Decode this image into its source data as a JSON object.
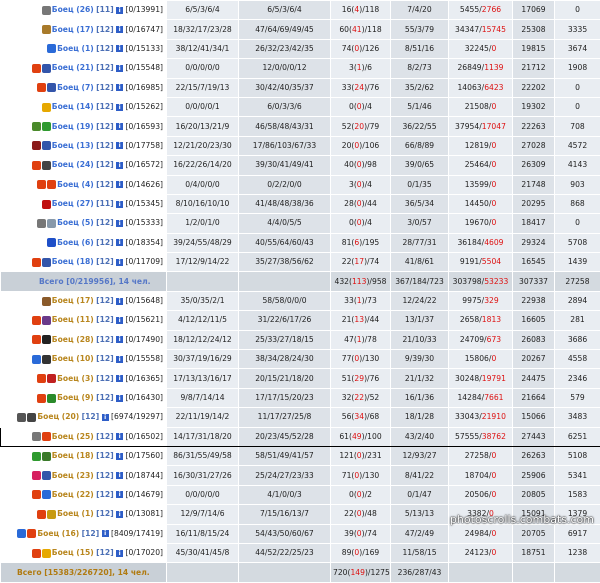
{
  "name_colors": {
    "blue": "#3b6fd4",
    "brown": "#b8861e",
    "total_blue": "#5577c7",
    "total_brown": "#b07a10"
  },
  "red_color": "#dd1111",
  "rows": [
    {
      "kind": "p",
      "team": "blue",
      "name": "Боец (26)",
      "lvl": "[11]",
      "id": "[0/13991]",
      "icons": [
        "gear-icon"
      ],
      "a": "6/5/3/6/4",
      "b": "6/5/3/6/4",
      "c1": "16(",
      "cr": "4",
      "c2": ")/118",
      "d": "7/4/20",
      "e1": "5455/",
      "er": "2766",
      "f": "17069",
      "g": "0"
    },
    {
      "kind": "p",
      "team": "blue",
      "name": "Боец (17)",
      "lvl": "[12]",
      "id": "[0/16747]",
      "icons": [
        "ornate-icon"
      ],
      "a": "18/32/17/23/28",
      "b": "47/64/69/49/45",
      "c1": "60(",
      "cr": "41",
      "c2": ")/118",
      "d": "55/3/79",
      "e1": "34347/",
      "er": "15745",
      "f": "25308",
      "g": "3335"
    },
    {
      "kind": "p",
      "team": "blue",
      "name": "Боец (1)",
      "lvl": "[12]",
      "id": "[0/15133]",
      "icons": [
        "orb-icon"
      ],
      "a": "38/12/41/34/1",
      "b": "26/32/23/42/35",
      "c1": "74(",
      "cr": "0",
      "c2": ")/126",
      "d": "8/51/16",
      "e1": "32245/",
      "er": "0",
      "f": "19815",
      "g": "3674"
    },
    {
      "kind": "p",
      "team": "blue",
      "name": "Боец (21)",
      "lvl": "[12]",
      "id": "[0/15548]",
      "icons": [
        "flame-icon",
        "shield-icon"
      ],
      "a": "0/0/0/0/0",
      "b": "12/0/0/0/12",
      "c1": "3(",
      "cr": "1",
      "c2": ")/6",
      "d": "8/2/73",
      "e1": "26849/",
      "er": "1139",
      "f": "21712",
      "g": "1908"
    },
    {
      "kind": "p",
      "team": "blue",
      "name": "Боец (7)",
      "lvl": "[12]",
      "id": "[0/16985]",
      "icons": [
        "flame-icon",
        "shield-icon"
      ],
      "a": "22/15/7/19/13",
      "b": "30/42/40/35/37",
      "c1": "33(",
      "cr": "24",
      "c2": ")/76",
      "d": "35/2/62",
      "e1": "14063/",
      "er": "6423",
      "f": "22202",
      "g": "0"
    },
    {
      "kind": "p",
      "team": "blue",
      "name": "Боец (14)",
      "lvl": "[12]",
      "id": "[0/15262]",
      "icons": [
        "sun-icon"
      ],
      "a": "0/0/0/0/1",
      "b": "6/0/3/3/6",
      "c1": "0(",
      "cr": "0",
      "c2": ")/4",
      "d": "5/1/46",
      "e1": "21508/",
      "er": "0",
      "f": "19302",
      "g": "0"
    },
    {
      "kind": "p",
      "team": "blue",
      "name": "Боец (19)",
      "lvl": "[12]",
      "id": "[0/16593]",
      "icons": [
        "bird-icon",
        "leaf-icon"
      ],
      "a": "16/20/13/21/9",
      "b": "46/58/48/43/31",
      "c1": "52(",
      "cr": "20",
      "c2": ")/79",
      "d": "36/22/55",
      "e1": "37954/",
      "er": "17047",
      "f": "22263",
      "g": "708"
    },
    {
      "kind": "p",
      "team": "blue",
      "name": "Боец (13)",
      "lvl": "[12]",
      "id": "[0/17758]",
      "icons": [
        "eagle-icon",
        "shield-icon"
      ],
      "a": "12/21/20/23/30",
      "b": "17/86/103/67/33",
      "c1": "20(",
      "cr": "0",
      "c2": ")/106",
      "d": "66/8/89",
      "e1": "12819/",
      "er": "0",
      "f": "27028",
      "g": "4572"
    },
    {
      "kind": "p",
      "team": "blue",
      "name": "Боец (24)",
      "lvl": "[12]",
      "id": "[0/16572]",
      "icons": [
        "flame-icon",
        "skull-icon"
      ],
      "a": "16/22/26/14/20",
      "b": "39/30/41/49/41",
      "c1": "40(",
      "cr": "0",
      "c2": ")/98",
      "d": "39/0/65",
      "e1": "25464/",
      "er": "0",
      "f": "26309",
      "g": "4143"
    },
    {
      "kind": "p",
      "team": "blue",
      "name": "Боец (4)",
      "lvl": "[12]",
      "id": "[0/14626]",
      "icons": [
        "flame-icon",
        "flame-icon"
      ],
      "a": "0/4/0/0/0",
      "b": "0/2/2/0/0",
      "c1": "3(",
      "cr": "0",
      "c2": ")/4",
      "d": "0/1/35",
      "e1": "13599/",
      "er": "0",
      "f": "21748",
      "g": "903"
    },
    {
      "kind": "p",
      "team": "blue",
      "name": "Боец (27)",
      "lvl": "[11]",
      "id": "[0/15345]",
      "icons": [
        "cross-icon"
      ],
      "a": "8/10/16/10/10",
      "b": "41/48/48/38/36",
      "c1": "28(",
      "cr": "0",
      "c2": ")/44",
      "d": "36/5/34",
      "e1": "14450/",
      "er": "0",
      "f": "20295",
      "g": "868"
    },
    {
      "kind": "p",
      "team": "blue",
      "name": "Боец (5)",
      "lvl": "[12]",
      "id": "[0/15333]",
      "icons": [
        "gear-icon",
        "bell-icon"
      ],
      "a": "1/2/0/1/0",
      "b": "4/4/0/5/5",
      "c1": "0(",
      "cr": "0",
      "c2": ")/4",
      "d": "3/0/57",
      "e1": "19670/",
      "er": "0",
      "f": "18417",
      "g": "0"
    },
    {
      "kind": "p",
      "team": "blue",
      "name": "Боец (6)",
      "lvl": "[12]",
      "id": "[0/18354]",
      "icons": [
        "swirl-icon"
      ],
      "a": "39/24/55/48/29",
      "b": "40/55/64/60/43",
      "c1": "81(",
      "cr": "6",
      "c2": ")/195",
      "d": "28/77/31",
      "e1": "36184/",
      "er": "4609",
      "f": "29324",
      "g": "5708"
    },
    {
      "kind": "p",
      "team": "blue",
      "name": "Боец (18)",
      "lvl": "[12]",
      "id": "[0/11709]",
      "icons": [
        "flame-icon",
        "shield-icon"
      ],
      "a": "17/12/9/14/22",
      "b": "35/27/38/56/62",
      "c1": "22(",
      "cr": "17",
      "c2": ")/74",
      "d": "41/8/61",
      "e1": "9191/",
      "er": "5504",
      "f": "16545",
      "g": "1439"
    },
    {
      "kind": "t",
      "team": "total_blue",
      "label": "Всего [0/219956], 14 чел.",
      "a": "",
      "b": "",
      "c1": "432(",
      "cr": "113",
      "c2": ")/958",
      "d": "367/184/723",
      "e1": "303798/",
      "er": "53233",
      "f": "307337",
      "g": "27258"
    },
    {
      "kind": "p",
      "team": "brown",
      "name": "Боец (17)",
      "lvl": "[12]",
      "id": "[0/15648]",
      "icons": [
        "dragon-icon"
      ],
      "a": "35/0/35/2/1",
      "b": "58/58/0/0/0",
      "c1": "33(",
      "cr": "1",
      "c2": ")/73",
      "d": "12/24/22",
      "e1": "9975/",
      "er": "329",
      "f": "22938",
      "g": "2894"
    },
    {
      "kind": "p",
      "team": "brown",
      "name": "Боец (11)",
      "lvl": "[12]",
      "id": "[0/15621]",
      "icons": [
        "flame-icon",
        "mask-icon"
      ],
      "a": "4/12/12/11/5",
      "b": "31/22/6/17/26",
      "c1": "21(",
      "cr": "13",
      "c2": ")/44",
      "d": "13/1/37",
      "e1": "2658/",
      "er": "1813",
      "f": "16605",
      "g": "281"
    },
    {
      "kind": "p",
      "team": "brown",
      "name": "Боец (28)",
      "lvl": "[12]",
      "id": "[0/17490]",
      "icons": [
        "flame-icon",
        "bat-icon"
      ],
      "a": "18/12/12/24/12",
      "b": "25/33/27/18/15",
      "c1": "47(",
      "cr": "1",
      "c2": ")/78",
      "d": "21/10/33",
      "e1": "24709/",
      "er": "673",
      "f": "26083",
      "g": "3686"
    },
    {
      "kind": "p",
      "team": "brown",
      "name": "Боец (10)",
      "lvl": "[12]",
      "id": "[0/15558]",
      "icons": [
        "orb-icon",
        "horse-icon"
      ],
      "a": "30/37/19/16/29",
      "b": "38/34/28/24/30",
      "c1": "77(",
      "cr": "0",
      "c2": ")/130",
      "d": "9/39/30",
      "e1": "15806/",
      "er": "0",
      "f": "20267",
      "g": "4558"
    },
    {
      "kind": "p",
      "team": "brown",
      "name": "Боец (3)",
      "lvl": "[12]",
      "id": "[0/16365]",
      "icons": [
        "flame-icon",
        "flag-icon"
      ],
      "a": "17/13/13/16/17",
      "b": "20/15/21/18/20",
      "c1": "51(",
      "cr": "29",
      "c2": ")/76",
      "d": "21/1/32",
      "e1": "30248/",
      "er": "19791",
      "f": "24475",
      "g": "2346"
    },
    {
      "kind": "p",
      "team": "brown",
      "name": "Боец (9)",
      "lvl": "[12]",
      "id": "[0/16430]",
      "icons": [
        "flame-icon",
        "clover-icon"
      ],
      "a": "9/8/7/14/14",
      "b": "17/17/15/20/23",
      "c1": "32(",
      "cr": "22",
      "c2": ")/52",
      "d": "16/1/36",
      "e1": "14284/",
      "er": "7661",
      "f": "21664",
      "g": "579"
    },
    {
      "kind": "p",
      "team": "brown",
      "name": "Боец (20)",
      "lvl": "[12]",
      "id": "[6974/19297]",
      "icons": [
        "sword-icon",
        "skull-icon"
      ],
      "a": "22/11/19/14/2",
      "b": "11/17/27/25/8",
      "c1": "56(",
      "cr": "34",
      "c2": ")/68",
      "d": "18/1/28",
      "e1": "33043/",
      "er": "21910",
      "f": "15066",
      "g": "3483"
    },
    {
      "kind": "p",
      "team": "brown",
      "name": "Боец (25)",
      "lvl": "[12]",
      "id": "[0/16502]",
      "icons": [
        "gear-icon",
        "flame-icon"
      ],
      "a": "14/17/31/18/20",
      "b": "20/23/45/52/28",
      "c1": "61(",
      "cr": "49",
      "c2": ")/100",
      "d": "43/2/40",
      "e1": "57555/",
      "er": "38762",
      "f": "27443",
      "g": "6251",
      "hl": true
    },
    {
      "kind": "p",
      "team": "brown",
      "name": "Боец (18)",
      "lvl": "[12]",
      "id": "[0/17560]",
      "icons": [
        "leaf-icon",
        "tree-icon"
      ],
      "a": "86/31/55/49/58",
      "b": "58/51/49/41/57",
      "c1": "121(",
      "cr": "0",
      "c2": ")/231",
      "d": "12/93/27",
      "e1": "27258/",
      "er": "0",
      "f": "26263",
      "g": "5108"
    },
    {
      "kind": "p",
      "team": "brown",
      "name": "Боец (23)",
      "lvl": "[12]",
      "id": "[0/18744]",
      "icons": [
        "gem-icon",
        "shield-icon"
      ],
      "a": "16/30/31/27/26",
      "b": "25/24/27/23/33",
      "c1": "71(",
      "cr": "0",
      "c2": ")/130",
      "d": "8/41/22",
      "e1": "18704/",
      "er": "0",
      "f": "25906",
      "g": "5341"
    },
    {
      "kind": "p",
      "team": "brown",
      "name": "Боец (22)",
      "lvl": "[12]",
      "id": "[0/14679]",
      "icons": [
        "flame-icon",
        "orb-icon"
      ],
      "a": "0/0/0/0/0",
      "b": "4/1/0/0/3",
      "c1": "0(",
      "cr": "0",
      "c2": ")/2",
      "d": "0/1/47",
      "e1": "20506/",
      "er": "0",
      "f": "20805",
      "g": "1583"
    },
    {
      "kind": "p",
      "team": "brown",
      "name": "Боец (1)",
      "lvl": "[12]",
      "id": "[0/13081]",
      "icons": [
        "flame-icon",
        "crown-icon"
      ],
      "a": "12/9/7/14/6",
      "b": "7/15/16/13/7",
      "c1": "22(",
      "cr": "0",
      "c2": ")/48",
      "d": "5/13/13",
      "e1": "3382/",
      "er": "0",
      "f": "15091",
      "g": "1379"
    },
    {
      "kind": "p",
      "team": "brown",
      "name": "Боец (16)",
      "lvl": "[12]",
      "id": "[8409/17419]",
      "icons": [
        "orb-icon",
        "flame-icon"
      ],
      "a": "16/11/8/15/24",
      "b": "54/43/50/60/67",
      "c1": "39(",
      "cr": "0",
      "c2": ")/74",
      "d": "47/2/49",
      "e1": "24984/",
      "er": "0",
      "f": "20705",
      "g": "6917"
    },
    {
      "kind": "p",
      "team": "brown",
      "name": "Боец (15)",
      "lvl": "[12]",
      "id": "[0/17020]",
      "icons": [
        "flame-icon",
        "sun-icon"
      ],
      "a": "45/30/41/45/8",
      "b": "44/52/22/25/23",
      "c1": "89(",
      "cr": "0",
      "c2": ")/169",
      "d": "11/58/15",
      "e1": "24123/",
      "er": "0",
      "f": "18751",
      "g": "1238"
    },
    {
      "kind": "t",
      "team": "total_brown",
      "label": "Всего [15383/226720], 14 чел.",
      "a": "",
      "b": "",
      "c1": "720(",
      "cr": "149",
      "c2": ")/1275",
      "d": "236/287/43",
      "e1": "",
      "er": "",
      "f": "",
      "g": ""
    }
  ],
  "watermark": "photoscrolls.combats.com"
}
